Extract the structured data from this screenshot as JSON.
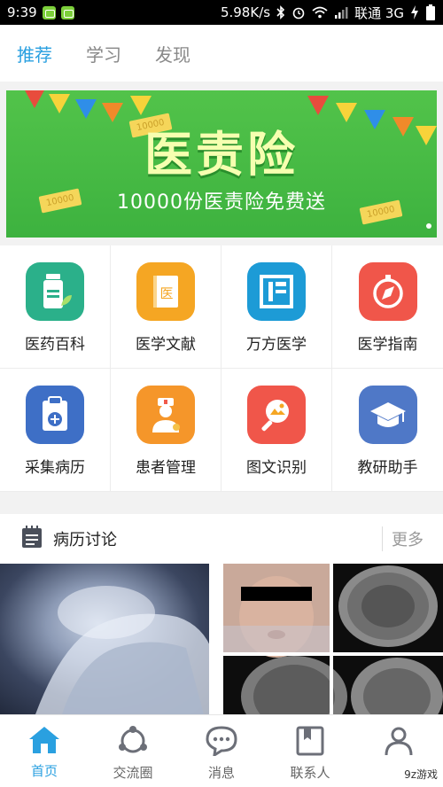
{
  "status_bar": {
    "time": "9:39",
    "network_speed": "5.98K/s",
    "carrier": "联通 3G"
  },
  "top_tabs": [
    {
      "label": "推荐",
      "active": true
    },
    {
      "label": "学习",
      "active": false
    },
    {
      "label": "发现",
      "active": false
    }
  ],
  "banner": {
    "title": "医责险",
    "subtitle": "10000份医责险免费送",
    "ticket_text": "10000"
  },
  "grid": [
    {
      "label": "医药百科",
      "icon": "medicine-bottle-icon",
      "color": "#2bb08a"
    },
    {
      "label": "医学文献",
      "icon": "document-book-icon",
      "color": "#f5a623"
    },
    {
      "label": "万方医学",
      "icon": "wanfang-logo-icon",
      "color": "#1d9bd6"
    },
    {
      "label": "医学指南",
      "icon": "compass-icon",
      "color": "#f0564a"
    },
    {
      "label": "采集病历",
      "icon": "clipboard-plus-icon",
      "color": "#3e6fc6"
    },
    {
      "label": "患者管理",
      "icon": "doctor-icon",
      "color": "#f5962a"
    },
    {
      "label": "图文识别",
      "icon": "image-search-icon",
      "color": "#f0564a"
    },
    {
      "label": "教研助手",
      "icon": "graduation-cap-icon",
      "color": "#4f78c7"
    }
  ],
  "section": {
    "title": "病历讨论",
    "more": "更多"
  },
  "bottom_nav": [
    {
      "label": "首页",
      "icon": "home-icon",
      "active": true
    },
    {
      "label": "交流圈",
      "icon": "circle-community-icon",
      "active": false
    },
    {
      "label": "消息",
      "icon": "chat-bubble-icon",
      "active": false
    },
    {
      "label": "联系人",
      "icon": "contacts-book-icon",
      "active": false
    },
    {
      "label": "",
      "icon": "profile-icon",
      "active": false
    }
  ],
  "colors": {
    "accent": "#2aa0e0",
    "banner_green": "#3db23f"
  },
  "watermark": "9z游戏"
}
